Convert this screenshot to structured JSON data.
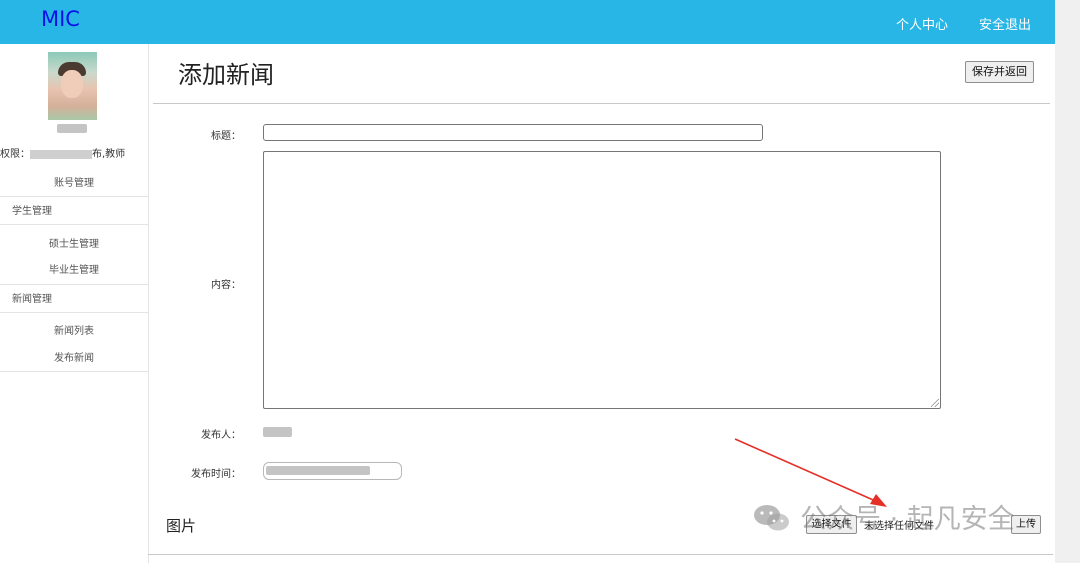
{
  "header": {
    "logo": "MIC",
    "nav": [
      "个人中心",
      "安全退出"
    ]
  },
  "sidebar": {
    "permission_prefix": "权限：",
    "permission_suffix": "布,教师",
    "account_item": "账号管理",
    "groups": [
      {
        "label": "学生管理",
        "items": [
          "硕士生管理",
          "毕业生管理"
        ]
      },
      {
        "label": "新闻管理",
        "items": [
          "新闻列表",
          "发布新闻"
        ]
      }
    ]
  },
  "main": {
    "title": "添加新闻",
    "save_button": "保存并返回",
    "fields": {
      "title_label": "标题：",
      "content_label": "内容：",
      "publisher_label": "发布人：",
      "time_label": "发布时间："
    },
    "image_section": {
      "title": "图片",
      "choose_file": "选择文件",
      "no_file": "未选择任何文件",
      "upload": "上传"
    }
  },
  "watermark": "公众号 · 起凡安全",
  "colors": {
    "topbar": "#27b6e6",
    "logo": "#0a12e8",
    "arrow": "#e53027"
  }
}
